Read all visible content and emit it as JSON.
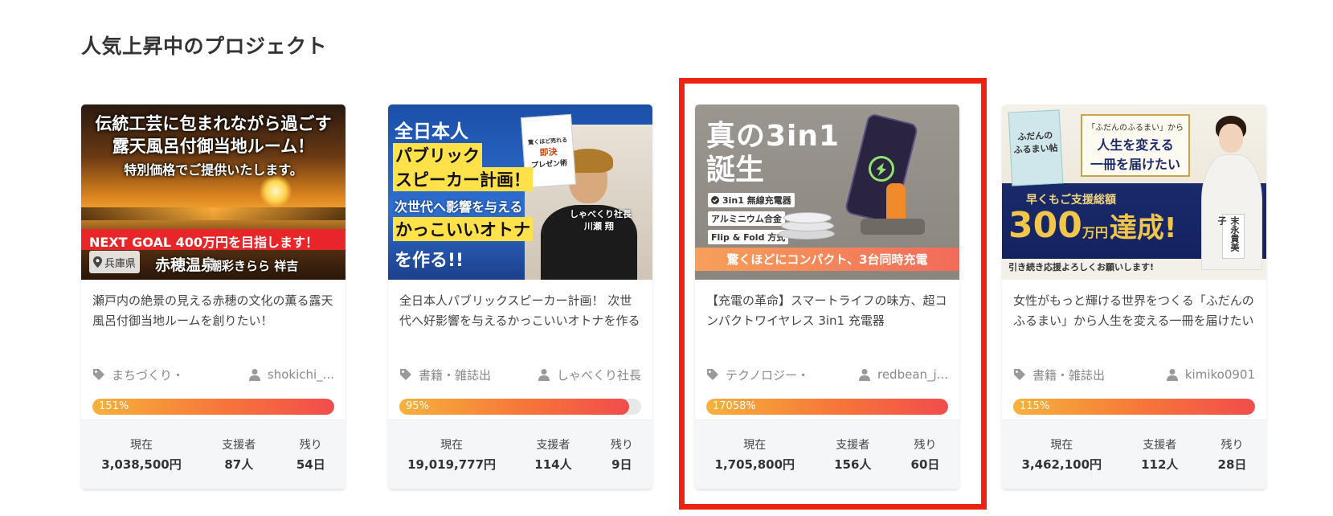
{
  "section": {
    "title": "人気上昇中のプロジェクト"
  },
  "colors": {
    "highlight": "#ee2211",
    "progress_start": "#f7b23b",
    "progress_end": "#f24c4c"
  },
  "cards": [
    {
      "thumb": {
        "lines": [
          "伝統工芸に包まれながら過ごす",
          "露天風呂付御当地ルーム！",
          "特別価格でご提供いたします。"
        ],
        "goal": "NEXT GOAL 400万円を目指します！",
        "location": "兵庫県",
        "place": "赤穂温泉",
        "hotel": "潮彩きらら 祥吉"
      },
      "title": "瀬戸内の絶景の見える赤穂の文化の薫る露天風呂付御当地ルームを創りたい！",
      "category": "まちづくり・",
      "author": "shokichi_...",
      "percent_label": "151%",
      "progress": 1.0,
      "stats": [
        {
          "label": "現在",
          "value": "3,038,500円"
        },
        {
          "label": "支援者",
          "value": "87人"
        },
        {
          "label": "残り",
          "value": "54日"
        }
      ]
    },
    {
      "thumb": {
        "lines": [
          "全日本人",
          "パブリック",
          "スピーカー計画！",
          "次世代へ影響を与える",
          "かっこいいオトナ",
          "を作る!!"
        ],
        "book_lines": [
          "驚くほど売れる",
          "即決",
          "プレゼン術"
        ],
        "caption": "しゃべくり社長",
        "name": "川瀬 翔"
      },
      "title": "全日本人パブリックスピーカー計画！ 次世代へ好影響を与えるかっこいいオトナを作る",
      "category": "書籍・雑誌出",
      "author": "しゃべくり社長",
      "percent_label": "95%",
      "progress": 0.95,
      "stats": [
        {
          "label": "現在",
          "value": "19,019,777円"
        },
        {
          "label": "支援者",
          "value": "114人"
        },
        {
          "label": "残り",
          "value": "9日"
        }
      ]
    },
    {
      "thumb": {
        "lines": [
          "真の3in1",
          "誕生"
        ],
        "tags": [
          "3in1 無線充電器",
          "アルミニウム合金",
          "Flip & Fold 方式"
        ],
        "banner": "驚くほどにコンパクト、3台同時充電"
      },
      "title": "【充電の革命】スマートライフの味方、超コンパクトワイヤレス 3in1 充電器",
      "category": "テクノロジー・",
      "author": "redbean_j...",
      "percent_label": "17058%",
      "progress": 1.0,
      "stats": [
        {
          "label": "現在",
          "value": "1,705,800円"
        },
        {
          "label": "支援者",
          "value": "156人"
        },
        {
          "label": "残り",
          "value": "60日"
        }
      ]
    },
    {
      "thumb": {
        "book_lines": [
          "ふだんの",
          "ふるまい帖"
        ],
        "quote_lines": [
          "「ふだんのふるまい」から",
          "人生を変える",
          "一冊を届けたい"
        ],
        "early": "早くもご支援総額",
        "big": "300",
        "unit": "万円",
        "achieved": "達成!",
        "name": "末永貴美子",
        "footer": "引き続き応援よろしくお願いします!"
      },
      "title": "女性がもっと輝ける世界をつくる「ふだんのふるまい」から人生を変える一冊を届けたい",
      "category": "書籍・雑誌出",
      "author": "kimiko0901",
      "percent_label": "115%",
      "progress": 1.0,
      "stats": [
        {
          "label": "現在",
          "value": "3,462,100円"
        },
        {
          "label": "支援者",
          "value": "112人"
        },
        {
          "label": "残り",
          "value": "28日"
        }
      ]
    }
  ]
}
